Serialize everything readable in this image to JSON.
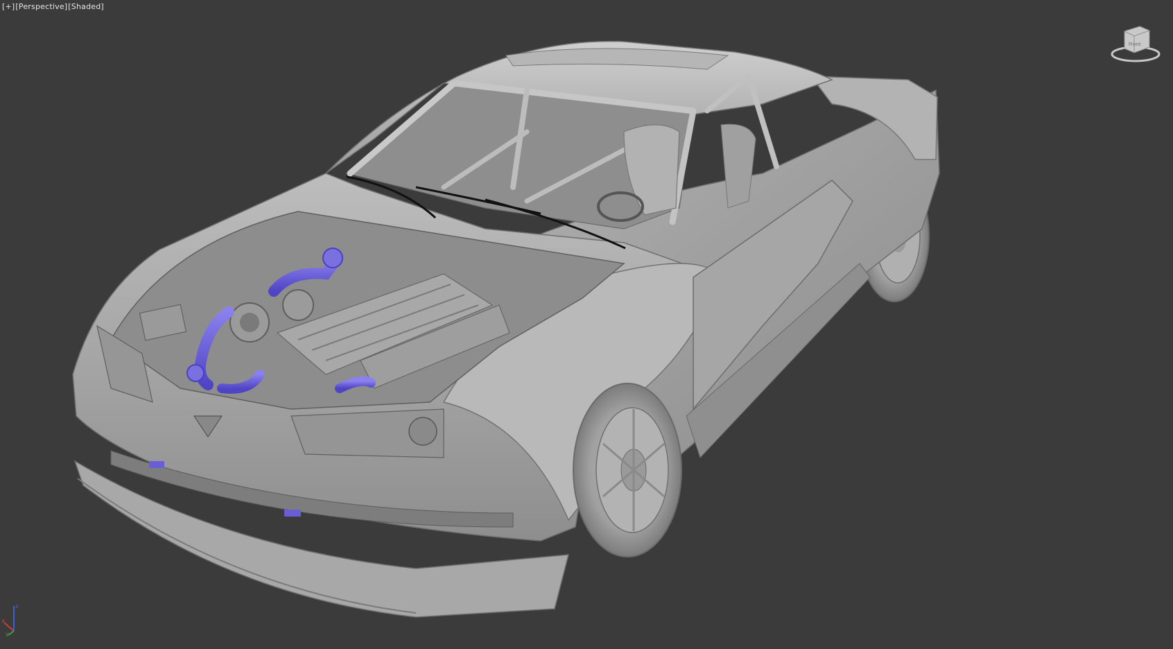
{
  "viewport": {
    "menu_label": "[+]",
    "view_label": "[Perspective]",
    "shading_label": "[Shaded]"
  },
  "viewcube": {
    "face_label": "Front",
    "icon": "viewcube-icon"
  },
  "axis_tripod": {
    "x": "x",
    "y": "y",
    "z": "z",
    "x_color": "#c84040",
    "y_color": "#40a040",
    "z_color": "#4060d0"
  },
  "scene": {
    "model_name": "race car model",
    "body_color": "#a9a9a9",
    "pipe_color": "#6a5ed6",
    "background_color": "#3b3b3b"
  }
}
